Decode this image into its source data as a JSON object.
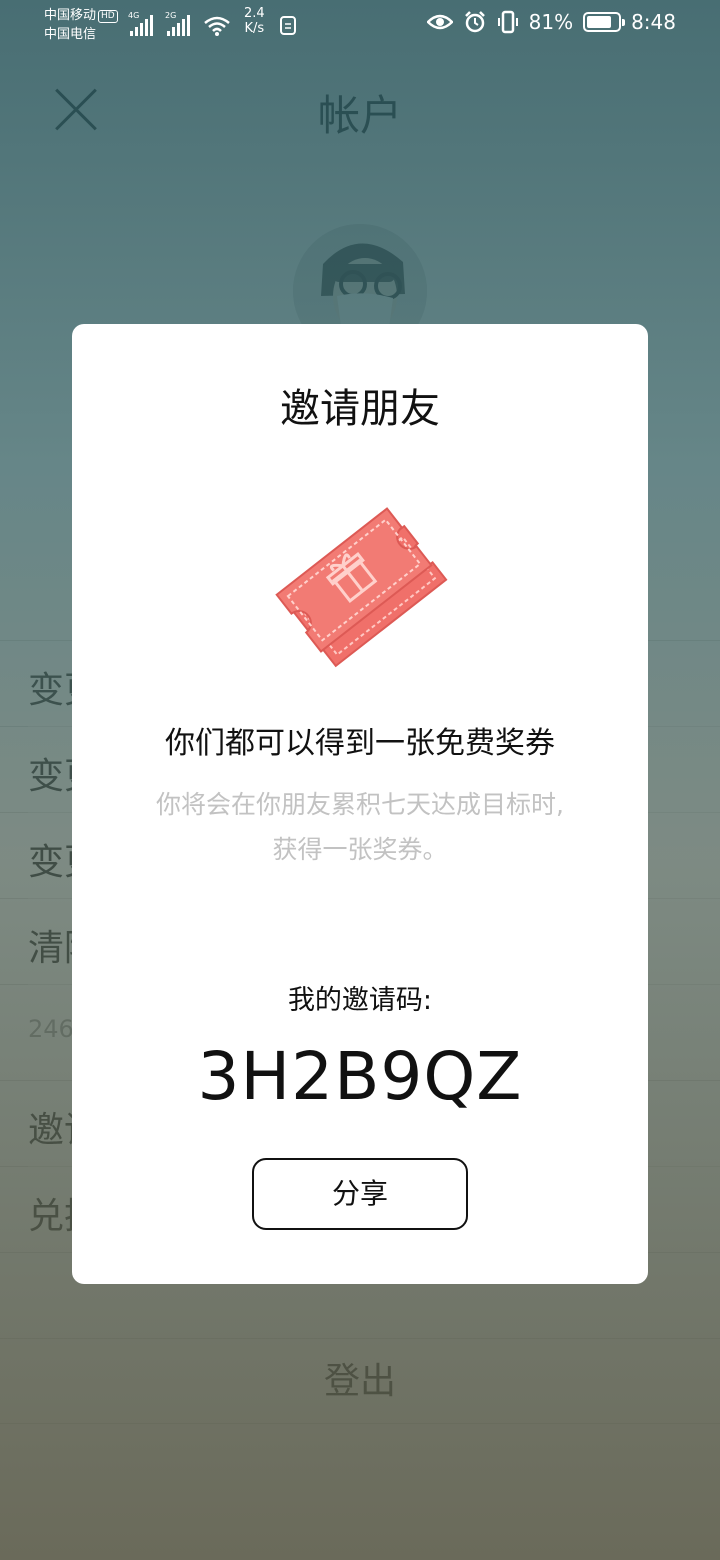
{
  "status_bar": {
    "carrier_1": "中国移动",
    "hd_badge": "HD",
    "carrier_2": "中国电信",
    "network_1": "4G",
    "network_2": "2G",
    "speed_value": "2.4",
    "speed_unit": "K/s",
    "battery": "81%",
    "time": "8:48",
    "battery_level": 0.81
  },
  "header": {
    "title": "帐户"
  },
  "menu": {
    "items": [
      {
        "label": "变更"
      },
      {
        "label": "变更"
      },
      {
        "label": "变更"
      },
      {
        "label": "清除"
      },
      {
        "label": "246"
      },
      {
        "label": "邀请"
      },
      {
        "label": "兑换"
      }
    ],
    "logout_label": "登出"
  },
  "dialog": {
    "title": "邀请朋友",
    "icon": "gift-ticket-icon",
    "icon_color": "#f0706a",
    "headline": "你们都可以得到一张免费奖券",
    "subtext_line1": "你将会在你朋友累积七天达成目标时,",
    "subtext_line2": "获得一张奖券。",
    "code_label": "我的邀请码:",
    "invite_code": "3H2B9QZ",
    "share_label": "分享"
  }
}
